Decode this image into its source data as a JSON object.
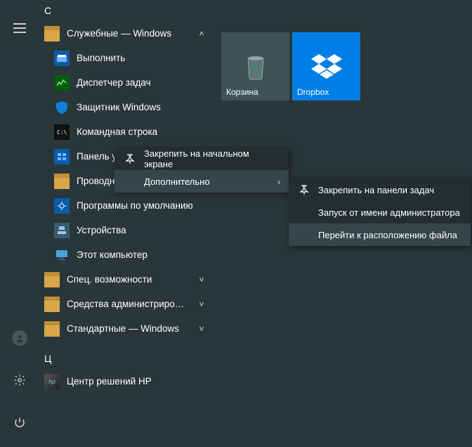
{
  "letters": {
    "s": "С",
    "ts": "Ц"
  },
  "apps": {
    "services": {
      "label": "Служебные — Windows"
    },
    "run": {
      "label": "Выполнить"
    },
    "taskmgr": {
      "label": "Диспетчер задач"
    },
    "defender": {
      "label": "Защитник Windows"
    },
    "cmd": {
      "label": "Командная строка"
    },
    "ctrlpanel": {
      "label": "Панель управления"
    },
    "explorer": {
      "label": "Проводник"
    },
    "defaults": {
      "label": "Программы по умолчанию"
    },
    "devices": {
      "label": "Устройства"
    },
    "thispc": {
      "label": "Этот компьютер"
    },
    "ease": {
      "label": "Спец. возможности"
    },
    "admin": {
      "label": "Средства администрировани..."
    },
    "std": {
      "label": "Стандартные — Windows"
    },
    "hp": {
      "label": "Центр решений HP"
    }
  },
  "tiles": {
    "recycle": {
      "label": "Корзина"
    },
    "dropbox": {
      "label": "Dropbox"
    }
  },
  "ctx1": {
    "pin_start": "Закрепить на начальном экране",
    "more": "Дополнительно"
  },
  "ctx2": {
    "pin_taskbar": "Закрепить на панели задач",
    "run_admin": "Запуск от имени администратора",
    "open_loc": "Перейти к расположению файла"
  }
}
